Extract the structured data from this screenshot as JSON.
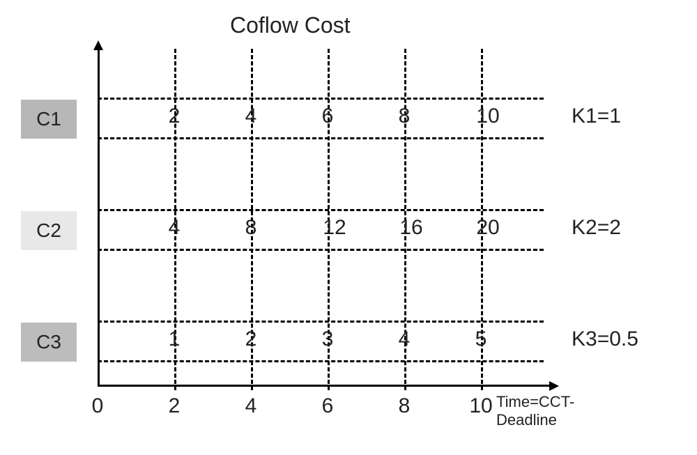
{
  "title": "Coflow Cost",
  "x_axis_label": "Time=CCT-Deadline",
  "x_ticks": [
    0,
    2,
    4,
    6,
    8,
    10
  ],
  "rows": [
    {
      "id": "C1",
      "k_label": "K1=1",
      "values": [
        2,
        4,
        6,
        8,
        10
      ],
      "shade": "c1"
    },
    {
      "id": "C2",
      "k_label": "K2=2",
      "values": [
        4,
        8,
        12,
        16,
        20
      ],
      "shade": "c2"
    },
    {
      "id": "C3",
      "k_label": "K3=0.5",
      "values": [
        1,
        2,
        3,
        4,
        5
      ],
      "shade": "c3"
    }
  ],
  "chart_data": {
    "type": "table",
    "title": "Coflow Cost",
    "xlabel": "Time=CCT-Deadline",
    "ylabel": "",
    "x": [
      2,
      4,
      6,
      8,
      10
    ],
    "series": [
      {
        "name": "C1",
        "values": [
          2,
          4,
          6,
          8,
          10
        ],
        "k": 1
      },
      {
        "name": "C2",
        "values": [
          4,
          8,
          12,
          16,
          20
        ],
        "k": 2
      },
      {
        "name": "C3",
        "values": [
          1,
          2,
          3,
          4,
          5
        ],
        "k": 0.5
      }
    ],
    "xlim": [
      0,
      10
    ]
  }
}
